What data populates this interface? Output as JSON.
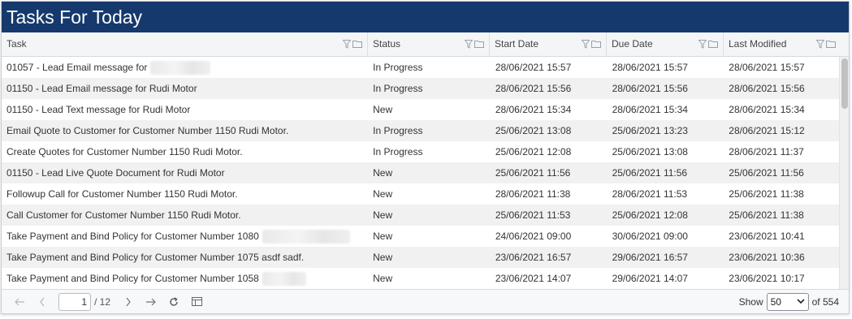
{
  "panel": {
    "title": "Tasks For Today"
  },
  "columns": [
    {
      "label": "Task"
    },
    {
      "label": "Status"
    },
    {
      "label": "Start Date"
    },
    {
      "label": "Due Date"
    },
    {
      "label": "Last Modified"
    }
  ],
  "rows": [
    {
      "task": "01057 - Lead Email message for",
      "status": "In Progress",
      "start": "28/06/2021 15:57",
      "due": "28/06/2021 15:57",
      "modified": "28/06/2021 15:57"
    },
    {
      "task": "01150 - Lead Email message for Rudi Motor",
      "status": "In Progress",
      "start": "28/06/2021 15:56",
      "due": "28/06/2021 15:56",
      "modified": "28/06/2021 15:56"
    },
    {
      "task": "01150 - Lead Text message for Rudi Motor",
      "status": "New",
      "start": "28/06/2021 15:34",
      "due": "28/06/2021 15:34",
      "modified": "28/06/2021 15:34"
    },
    {
      "task": "Email Quote to Customer for Customer Number 1150 Rudi Motor.",
      "status": "In Progress",
      "start": "25/06/2021 13:08",
      "due": "25/06/2021 13:23",
      "modified": "28/06/2021 15:12"
    },
    {
      "task": "Create Quotes for Customer Number 1150 Rudi Motor.",
      "status": "In Progress",
      "start": "25/06/2021 12:08",
      "due": "25/06/2021 13:08",
      "modified": "28/06/2021 11:37"
    },
    {
      "task": "01150 - Lead Live Quote Document for Rudi Motor",
      "status": "New",
      "start": "25/06/2021 11:56",
      "due": "25/06/2021 11:56",
      "modified": "25/06/2021 11:56"
    },
    {
      "task": "Followup Call for Customer Number 1150 Rudi Motor.",
      "status": "New",
      "start": "28/06/2021 11:38",
      "due": "28/06/2021 11:53",
      "modified": "25/06/2021 11:38"
    },
    {
      "task": "Call Customer for Customer Number 1150 Rudi Motor.",
      "status": "New",
      "start": "25/06/2021 11:53",
      "due": "25/06/2021 12:08",
      "modified": "25/06/2021 11:38"
    },
    {
      "task": "Take Payment and Bind Policy for Customer Number 1080",
      "status": "New",
      "start": "24/06/2021 09:00",
      "due": "30/06/2021 09:00",
      "modified": "23/06/2021 10:41"
    },
    {
      "task": "Take Payment and Bind Policy for Customer Number 1075 asdf sadf.",
      "status": "New",
      "start": "23/06/2021 16:57",
      "due": "29/06/2021 16:57",
      "modified": "23/06/2021 10:36"
    },
    {
      "task": "Take Payment and Bind Policy for Customer Number 1058",
      "status": "New",
      "start": "23/06/2021 14:07",
      "due": "29/06/2021 14:07",
      "modified": "23/06/2021 10:17"
    }
  ],
  "pager": {
    "current_page": "1",
    "total_pages": "/ 12",
    "show_label": "Show",
    "page_size": "50",
    "total_records": "of 554"
  },
  "colors": {
    "title_bar": "#16396d",
    "row_alt": "#f1f1f1"
  },
  "icons": {
    "filter": "filter-icon",
    "column_menu": "folder-icon",
    "first": "first-page-icon",
    "prev": "previous-page-icon",
    "next": "next-page-icon",
    "last": "last-page-icon",
    "refresh": "refresh-icon",
    "export": "export-icon"
  }
}
